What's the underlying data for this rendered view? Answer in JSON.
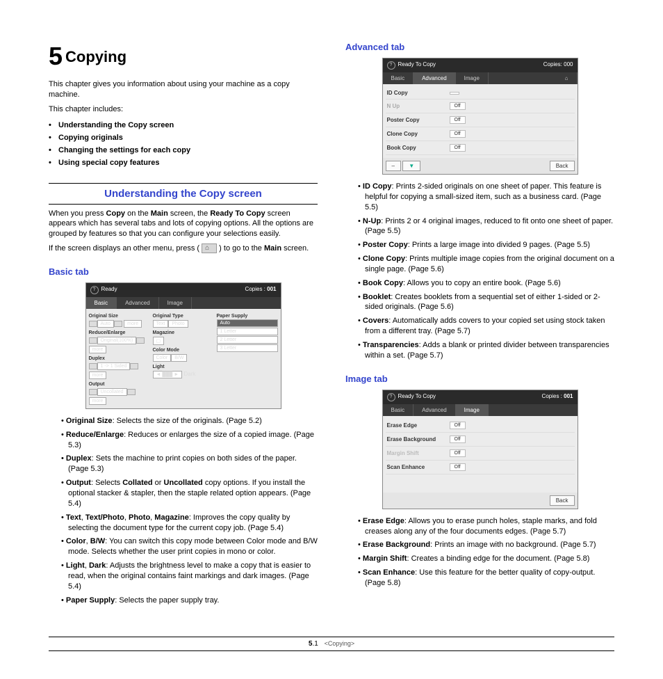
{
  "chapter": {
    "num": "5",
    "title": "Copying"
  },
  "intro1": "This chapter gives you information about using your machine as a copy machine.",
  "intro2": "This chapter includes:",
  "toc": [
    "Understanding the Copy screen",
    "Copying originals",
    "Changing the settings for each copy",
    "Using special copy features"
  ],
  "section1": {
    "heading": "Understanding the Copy screen",
    "p1a": "When you press ",
    "p1b": "Copy",
    "p1c": " on the ",
    "p1d": "Main",
    "p1e": " screen, the ",
    "p1f": "Ready To Copy",
    "p1g": " screen appears which has several tabs and lots of copying options. All the options are grouped by features so that you can configure your selections easily.",
    "p2a": "If the screen displays an other menu, press ( ",
    "p2b": " ) to go to the ",
    "p2c": "Main",
    "p2d": " screen."
  },
  "basic": {
    "heading": "Basic tab",
    "screen": {
      "title": "Ready",
      "copies_label": "Copies :",
      "copies_val": "001",
      "tabs": [
        "Basic",
        "Advanced",
        "Image"
      ],
      "groups": {
        "c1": [
          "Original Size",
          "Reduce/Enlarge",
          "Duplex",
          "Output"
        ],
        "c1vals": [
          "Auto",
          "Original(100%)",
          "1 -> 1 Sided",
          "Uncollated"
        ],
        "c2": [
          "Original Type",
          "Magazine",
          "Color Mode",
          "Light"
        ],
        "c3": "Paper Supply",
        "c3vals": [
          "Auto",
          "1  Letter",
          "2  Letter",
          "3  Letter"
        ]
      },
      "more": "more",
      "dark": "Dark"
    },
    "items": [
      {
        "b": "Original Size",
        "t": ": Selects the size of the originals. (Page 5.2)"
      },
      {
        "b": "Reduce/Enlarge",
        "t": ": Reduces or enlarges the size of a copied image. (Page 5.3)"
      },
      {
        "b": "Duplex",
        "t": ": Sets the machine to print copies on both sides of the paper. (Page 5.3)"
      },
      {
        "b": "Output",
        "t_pre": ": Selects ",
        "b2": "Collated",
        "t_mid": " or ",
        "b3": "Uncollated",
        "t_post": " copy options. If you install the optional stacker & stapler, then the staple related option appears. (Page 5.4)"
      },
      {
        "multi": [
          "Text",
          "Text/Photo",
          "Photo",
          "Magazine"
        ],
        "t": ": Improves the copy quality by selecting the document type for the current copy job. (Page 5.4)"
      },
      {
        "multi": [
          "Color",
          "B/W"
        ],
        "t": ": You can switch this copy mode between Color mode and B/W mode. Selects whether the user print copies in mono or color."
      },
      {
        "multi": [
          "Light",
          "Dark"
        ],
        "t": ": Adjusts the brightness level to make a copy that is easier to read, when the original contains faint markings and dark images. (Page 5.4)"
      },
      {
        "b": "Paper Supply",
        "t": ": Selects the paper supply tray."
      }
    ]
  },
  "advanced": {
    "heading": "Advanced tab",
    "screen": {
      "title": "Ready To Copy",
      "copies_label": "Copies:",
      "copies_val": "000",
      "tabs": [
        "Basic",
        "Advanced",
        "Image"
      ],
      "rows": [
        {
          "lbl": "ID Copy",
          "val": ""
        },
        {
          "lbl": "N Up",
          "val": "Off"
        },
        {
          "lbl": "Poster Copy",
          "val": "Off"
        },
        {
          "lbl": "Clone Copy",
          "val": "Off"
        },
        {
          "lbl": "Book Copy",
          "val": "Off"
        }
      ],
      "back": "Back"
    },
    "items": [
      {
        "b": "ID Copy",
        "t": ": Prints 2-sided originals on one sheet of paper. This feature is helpful for copying a small-sized item, such as a business card. (Page 5.5)"
      },
      {
        "b": "N-Up",
        "t": ": Prints 2 or 4 original images, reduced to fit onto one sheet of paper. (Page 5.5)"
      },
      {
        "b": "Poster Copy",
        "t": ": Prints a large image into divided 9 pages. (Page 5.5)"
      },
      {
        "b": "Clone Copy",
        "t": ": Prints multiple image copies from the original document on a single page. (Page 5.6)"
      },
      {
        "b": "Book Copy",
        "t": ": Allows you to copy an entire book. (Page 5.6)"
      },
      {
        "b": "Booklet",
        "t": ": Creates booklets from a sequential set of either 1-sided or 2-sided originals. (Page 5.6)"
      },
      {
        "b": "Covers",
        "t": ": Automatically adds covers to your copied set using stock taken from a different tray. (Page 5.7)"
      },
      {
        "b": "Transparencies",
        "t": ": Adds a blank or printed divider between transparencies within a set. (Page 5.7)"
      }
    ]
  },
  "image": {
    "heading": "Image tab",
    "screen": {
      "title": "Ready To Copy",
      "copies_label": "Copies :",
      "copies_val": "001",
      "tabs": [
        "Basic",
        "Advanced",
        "Image"
      ],
      "rows": [
        {
          "lbl": "Erase Edge",
          "val": "Off"
        },
        {
          "lbl": "Erase Background",
          "val": "Off"
        },
        {
          "lbl": "Margin Shift",
          "val": "Off"
        },
        {
          "lbl": "Scan Enhance",
          "val": "Off"
        }
      ],
      "back": "Back"
    },
    "items": [
      {
        "b": "Erase Edge",
        "t": ": Allows you to erase punch holes, staple marks, and fold creases along any of the four documents edges. (Page 5.7)"
      },
      {
        "b": "Erase Background",
        "t": ": Prints an image with no background. (Page 5.7)"
      },
      {
        "b": "Margin Shift",
        "t": ": Creates a binding edge for the document. (Page 5.8)"
      },
      {
        "b": "Scan Enhance",
        "t": ": Use this feature for the better quality of copy-output. (Page 5.8)"
      }
    ]
  },
  "footer": {
    "page": "5",
    "sub": ".1",
    "chapter": "<Copying>"
  }
}
